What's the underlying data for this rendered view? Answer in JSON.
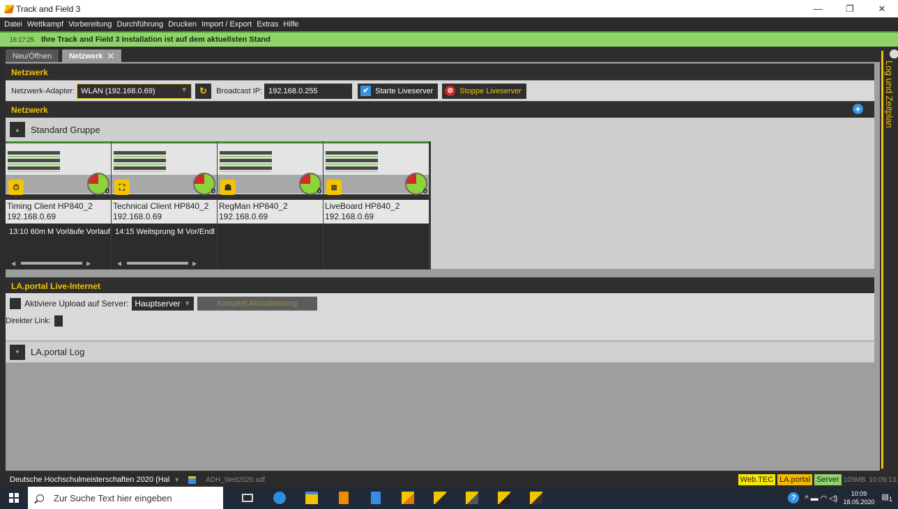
{
  "window": {
    "title": "Track and Field 3",
    "minimize": "—",
    "restore": "❐",
    "close": "✕"
  },
  "menu": [
    "Datei",
    "Wettkampf",
    "Vorbereitung",
    "Durchführung",
    "Drucken",
    "Import / Export",
    "Extras",
    "Hilfe"
  ],
  "status": {
    "time": "16:17:25",
    "message": "Ihre Track and Field 3 Installation ist auf dem aktuellsten Stand"
  },
  "tabs": [
    {
      "label": "Neu/Öffnen"
    },
    {
      "label": "Netzwerk",
      "close": "✕"
    }
  ],
  "sidebar": {
    "label": "Log und Zeitplan"
  },
  "netzwerk_section": {
    "title": "Netzwerk",
    "adapter_label": "Netzwerk-Adapter:",
    "adapter_value": "WLAN (192.168.0.69)",
    "broadcast_label": "Broadcast IP:",
    "broadcast_value": "192.168.0.255",
    "start_label": "Starte Liveserver",
    "stop_label": "Stoppe Liveserver"
  },
  "clients_section": {
    "title": "Netzwerk",
    "add_icon": "+",
    "group_title": "Standard Gruppe",
    "clients": [
      {
        "name": "Timing Client HP840_2",
        "ip": "192.168.0.69",
        "event": "13:10 60m M Vorläufe Vorlauf",
        "icon": "stopwatch-icon",
        "glyph": "⏱",
        "gauge": "0"
      },
      {
        "name": "Technical Client HP840_2",
        "ip": "192.168.0.69",
        "event": "14:15 Weitsprung M Vor/Endl",
        "icon": "hurdle-icon",
        "glyph": "⛶",
        "gauge": "0"
      },
      {
        "name": "RegMan HP840_2",
        "ip": "192.168.0.69",
        "event": "",
        "icon": "people-icon",
        "glyph": "☗",
        "gauge": "0"
      },
      {
        "name": "LiveBoard HP840_2",
        "ip": "192.168.0.69",
        "event": "",
        "icon": "database-icon",
        "glyph": "≣",
        "gauge": "0"
      }
    ]
  },
  "portal_section": {
    "title": "LA.portal Live-Internet",
    "upload_label": "Aktiviere Upload auf Server:",
    "server_value": "Hauptserver",
    "update_button": "Komplett Aktualisierung",
    "link_label": "Direkter Link:",
    "log_label": "LA.portal Log"
  },
  "bottombar": {
    "competition": "Deutsche Hochschulmeisterschaften 2020 (Hal",
    "file": "ADH_Weit2020.sdf",
    "badges": [
      "Web.TEC",
      "LA.portal",
      "Server"
    ],
    "memory": "105MB",
    "clock": "10:09:13.",
    "colors": {
      "web": "#f5e600",
      "laportal": "#f5b800",
      "server": "#8fd36a"
    }
  },
  "taskbar": {
    "search_placeholder": "Zur Suche Text hier eingeben",
    "time": "10:09",
    "date": "18.05.2020",
    "notification_count": "1"
  },
  "colors": {
    "accent": "#f5c400",
    "dark": "#2d2d2d",
    "green": "#8fd36a"
  }
}
